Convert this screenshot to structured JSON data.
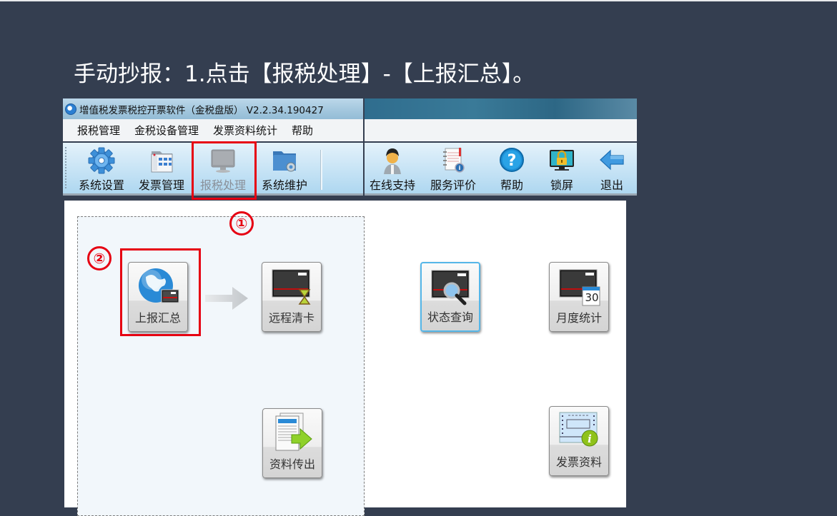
{
  "caption": "手动抄报：1.点击【报税处理】-【上报汇总】。",
  "window": {
    "title": "增值税发票税控开票软件（金税盘版） V2.2.34.190427",
    "menu": [
      "报税管理",
      "金税设备管理",
      "发票资料统计",
      "帮助"
    ],
    "toolbar_left": [
      {
        "label": "系统设置",
        "icon": "gear-icon",
        "disabled": false
      },
      {
        "label": "发票管理",
        "icon": "invoice-grid-icon",
        "disabled": false
      },
      {
        "label": "报税处理",
        "icon": "monitor-icon",
        "disabled": true
      },
      {
        "label": "系统维护",
        "icon": "folder-gear-icon",
        "disabled": false
      }
    ],
    "toolbar_right": [
      {
        "label": "在线支持",
        "icon": "user-support-icon"
      },
      {
        "label": "服务评价",
        "icon": "notebook-rating-icon"
      },
      {
        "label": "帮助",
        "icon": "help-icon"
      },
      {
        "label": "锁屏",
        "icon": "lock-screen-icon"
      },
      {
        "label": "退出",
        "icon": "exit-arrow-icon"
      }
    ]
  },
  "annotations": {
    "step1": "①",
    "step2": "②",
    "highlight_color": "#e60012"
  },
  "tiles": [
    {
      "label": "上报汇总",
      "icon": "globe-card-icon"
    },
    {
      "label": "远程清卡",
      "icon": "card-hourglass-icon"
    },
    {
      "label": "状态查询",
      "icon": "card-search-icon"
    },
    {
      "label": "月度统计",
      "icon": "card-calendar-icon",
      "calendar_day": "30"
    },
    {
      "label": "资料传出",
      "icon": "document-export-icon"
    },
    {
      "label": "发票资料",
      "icon": "invoice-info-icon"
    }
  ]
}
